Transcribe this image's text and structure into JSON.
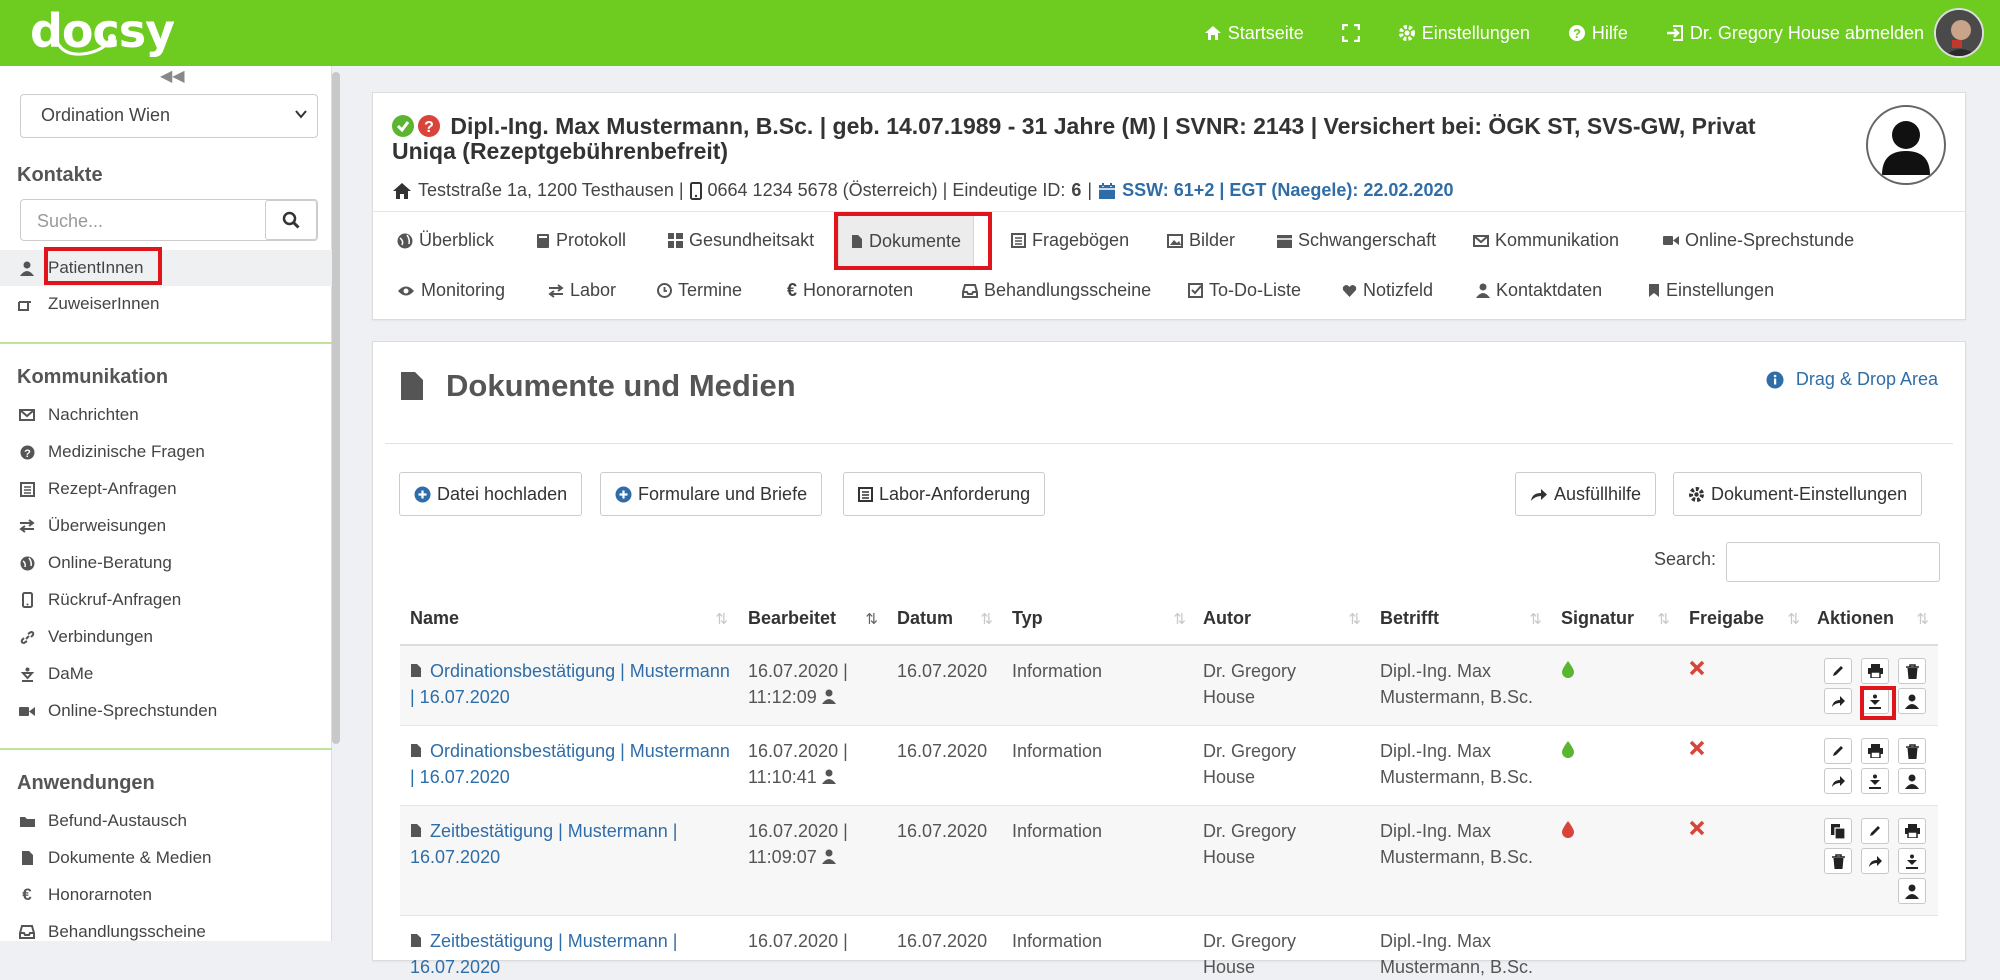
{
  "app": {
    "logo": "docsy"
  },
  "topnav": {
    "home": "Startseite",
    "settings": "Einstellungen",
    "help": "Hilfe",
    "logout": "Dr. Gregory House abmelden"
  },
  "sidebar": {
    "location": "Ordination Wien",
    "contacts_header": "Kontakte",
    "search_placeholder": "Suche...",
    "contacts": [
      {
        "label": "PatientInnen",
        "icon": "person-icon"
      },
      {
        "label": "ZuweiserInnen",
        "icon": "pointing-hand-icon"
      }
    ],
    "communication_header": "Kommunikation",
    "communication": [
      {
        "label": "Nachrichten",
        "icon": "envelope-icon"
      },
      {
        "label": "Medizinische Fragen",
        "icon": "question-icon"
      },
      {
        "label": "Rezept-Anfragen",
        "icon": "list-icon"
      },
      {
        "label": "Überweisungen",
        "icon": "transfer-icon"
      },
      {
        "label": "Online-Beratung",
        "icon": "globe-icon"
      },
      {
        "label": "Rückruf-Anfragen",
        "icon": "phone-icon"
      },
      {
        "label": "Verbindungen",
        "icon": "link-icon"
      },
      {
        "label": "DaMe",
        "icon": "dame-icon"
      },
      {
        "label": "Online-Sprechstunden",
        "icon": "video-icon"
      }
    ],
    "applications_header": "Anwendungen",
    "applications": [
      {
        "label": "Befund-Austausch",
        "icon": "folder-icon"
      },
      {
        "label": "Dokumente & Medien",
        "icon": "document-icon"
      },
      {
        "label": "Honorarnoten",
        "icon": "euro-icon"
      },
      {
        "label": "Behandlungsscheine",
        "icon": "inbox-icon"
      }
    ]
  },
  "patient": {
    "title": "Dipl.-Ing. Max Mustermann, B.Sc. | geb. 14.07.1989 - 31 Jahre (M) | SVNR: 2143 | Versichert bei: ÖGK ST, SVS-GW, Privat Uniqa (Rezeptgebührenbefreit)",
    "address": "Teststraße 1a, 1200 Testhausen |",
    "phone": "0664 1234 5678 (Österreich) | Eindeutige ID:",
    "id": "6",
    "pregnancy": "SSW: 61+2 | EGT (Naegele): 22.02.2020"
  },
  "tabs_row1": [
    "Überblick",
    "Protokoll",
    "Gesundheitsakt",
    "Dokumente",
    "Fragebögen",
    "Bilder",
    "Schwangerschaft",
    "Kommunikation",
    "Online-Sprechstunde"
  ],
  "tabs_row2": [
    "Monitoring",
    "Labor",
    "Termine",
    "Honorarnoten",
    "Behandlungsscheine",
    "To-Do-Liste",
    "Notizfeld",
    "Kontaktdaten",
    "Einstellungen"
  ],
  "docs": {
    "heading": "Dokumente und Medien",
    "drag_drop": "Drag & Drop Area",
    "btn_upload": "Datei hochladen",
    "btn_forms": "Formulare und Briefe",
    "btn_lab": "Labor-Anforderung",
    "btn_fill": "Ausfüllhilfe",
    "btn_settings": "Dokument-Einstellungen",
    "search_label": "Search:",
    "columns": [
      "Name",
      "Bearbeitet",
      "Datum",
      "Typ",
      "Autor",
      "Betrifft",
      "Signatur",
      "Freigabe",
      "Aktionen"
    ],
    "rows": [
      {
        "name": "Ordinationsbestätigung | Mustermann | 16.07.2020",
        "edited": "16.07.2020 | 11:12:09",
        "date": "16.07.2020",
        "type": "Information",
        "author": "Dr. Gregory House",
        "subject": "Dipl.-Ing. Max Mustermann, B.Sc."
      },
      {
        "name": "Ordinationsbestätigung | Mustermann | 16.07.2020",
        "edited": "16.07.2020 | 11:10:41",
        "date": "16.07.2020",
        "type": "Information",
        "author": "Dr. Gregory House",
        "subject": "Dipl.-Ing. Max Mustermann, B.Sc."
      },
      {
        "name": "Zeitbestätigung | Mustermann | 16.07.2020",
        "edited": "16.07.2020 | 11:09:07",
        "date": "16.07.2020",
        "type": "Information",
        "author": "Dr. Gregory House",
        "subject": "Dipl.-Ing. Max Mustermann, B.Sc."
      },
      {
        "name": "Zeitbestätigung | Mustermann | 16.07.2020",
        "edited": "16.07.2020 |",
        "date": "16.07.2020",
        "type": "Information",
        "author": "Dr. Gregory House",
        "subject": "Dipl.-Ing. Max Mustermann, B.Sc."
      }
    ]
  },
  "colors": {
    "brand": "#6ecb1f",
    "link": "#2f6da8",
    "highlight": "#e0141b",
    "sig_green": "#5cb531",
    "sig_red": "#d9443a"
  }
}
